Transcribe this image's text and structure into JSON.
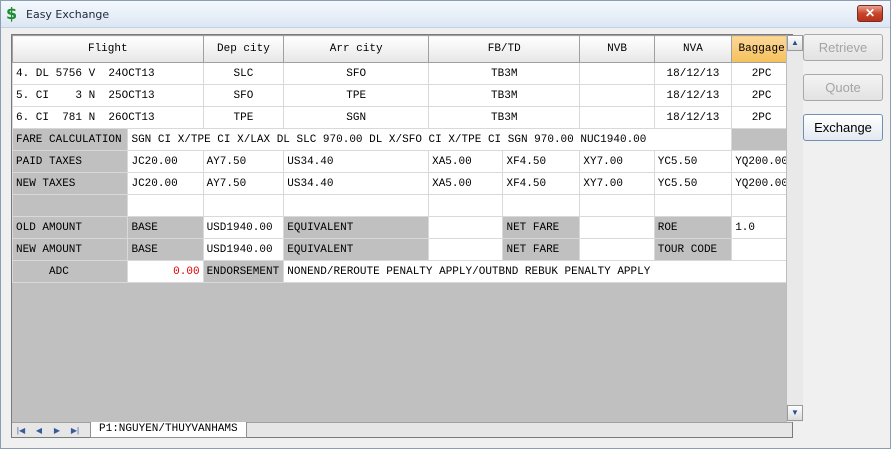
{
  "window": {
    "title": "Easy Exchange",
    "close_label": "✕"
  },
  "buttons": {
    "retrieve": "Retrieve",
    "quote": "Quote",
    "exchange": "Exchange"
  },
  "columns": [
    "Flight",
    "Dep city",
    "Arr city",
    "FB/TD",
    "NVB",
    "NVA",
    "Baggage"
  ],
  "flights": [
    {
      "flight": "4. DL 5756 V  24OCT13",
      "dep": "SLC",
      "arr": "SFO",
      "fb": "TB3M",
      "nvb": "",
      "nva": "18/12/13",
      "baggage": "2PC"
    },
    {
      "flight": "5. CI    3 N  25OCT13",
      "dep": "SFO",
      "arr": "TPE",
      "fb": "TB3M",
      "nvb": "",
      "nva": "18/12/13",
      "baggage": "2PC"
    },
    {
      "flight": "6. CI  781 N  26OCT13",
      "dep": "TPE",
      "arr": "SGN",
      "fb": "TB3M",
      "nvb": "",
      "nva": "18/12/13",
      "baggage": "2PC"
    }
  ],
  "fare_calc": {
    "label": "FARE CALCULATION",
    "value": "SGN CI X/TPE CI X/LAX DL SLC 970.00 DL X/SFO CI X/TPE CI SGN 970.00 NUC1940.00"
  },
  "paid_taxes": {
    "label": "PAID TAXES",
    "values": [
      "JC20.00",
      "AY7.50",
      "US34.40",
      "XA5.00",
      "XF4.50",
      "XY7.00",
      "YC5.50",
      "YQ200.00"
    ]
  },
  "new_taxes": {
    "label": "NEW TAXES",
    "values": [
      "JC20.00",
      "AY7.50",
      "US34.40",
      "XA5.00",
      "XF4.50",
      "XY7.00",
      "YC5.50",
      "YQ200.00"
    ]
  },
  "old_amount": {
    "label": "OLD AMOUNT",
    "base_label": "BASE",
    "base": "USD1940.00",
    "equiv_label": "EQUIVALENT",
    "equiv": "",
    "net_label": "NET FARE",
    "net": "",
    "roe_label": "ROE",
    "roe": "1.0"
  },
  "new_amount": {
    "label": "NEW AMOUNT",
    "base_label": "BASE",
    "base": "USD1940.00",
    "equiv_label": "EQUIVALENT",
    "equiv": "",
    "net_label": "NET FARE",
    "net": "",
    "tour_label": "TOUR CODE",
    "tour": ""
  },
  "adc": {
    "label": "ADC",
    "value": "0.00",
    "endorse_label": "ENDORSEMENT",
    "endorse": "NONEND/REROUTE PENALTY APPLY/OUTBND REBUK PENALTY APPLY"
  },
  "sheet_tab": "P1:NGUYEN/THUYVANHAMS",
  "colors": {
    "baggage_header": "#f6c05a",
    "adc_value": "#e00000",
    "close_button": "#c8452b"
  }
}
